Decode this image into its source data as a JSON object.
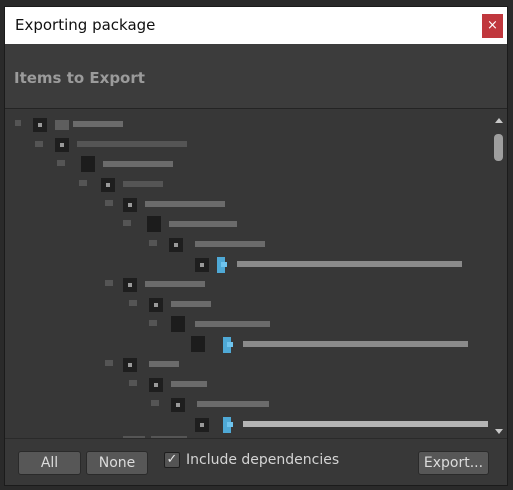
{
  "window": {
    "title": "Exporting package",
    "close_glyph": "×"
  },
  "header": {
    "title": "Items to Export"
  },
  "footer": {
    "all_label": "All",
    "none_label": "None",
    "include_dependencies_label": "Include dependencies",
    "include_dependencies_checked": true,
    "checkmark_glyph": "✓",
    "export_label": "Export..."
  },
  "colors": {
    "close_button": "#c0373d",
    "script_icon": "#4fa9d6"
  }
}
